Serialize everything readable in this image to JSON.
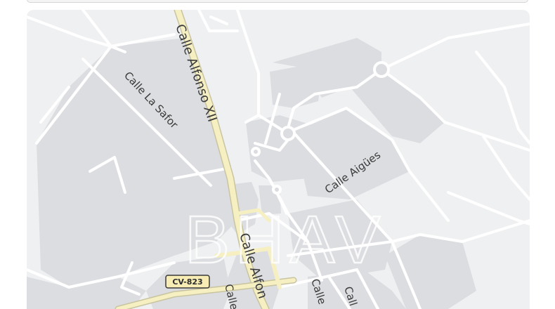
{
  "map": {
    "streets": [
      {
        "id": "alfonso-north",
        "name": "Calle Alfonso XII"
      },
      {
        "id": "la-safor",
        "name": "Calle La Safor"
      },
      {
        "id": "aigues",
        "name": "Calle Aigües"
      },
      {
        "id": "alfonso-south",
        "name": "Calle Alfon"
      },
      {
        "id": "calle-a",
        "name": "Calle"
      },
      {
        "id": "calle-b",
        "name": "Calle"
      },
      {
        "id": "calle-c",
        "name": "Call"
      }
    ],
    "road_shield": {
      "label": "CV-823"
    },
    "watermark": "BHAV",
    "colors": {
      "background": "#eff0f1",
      "block": "#dcdde0",
      "road": "#ffffff",
      "main_road": "#f5efc2",
      "label": "#3a3a3a"
    }
  }
}
